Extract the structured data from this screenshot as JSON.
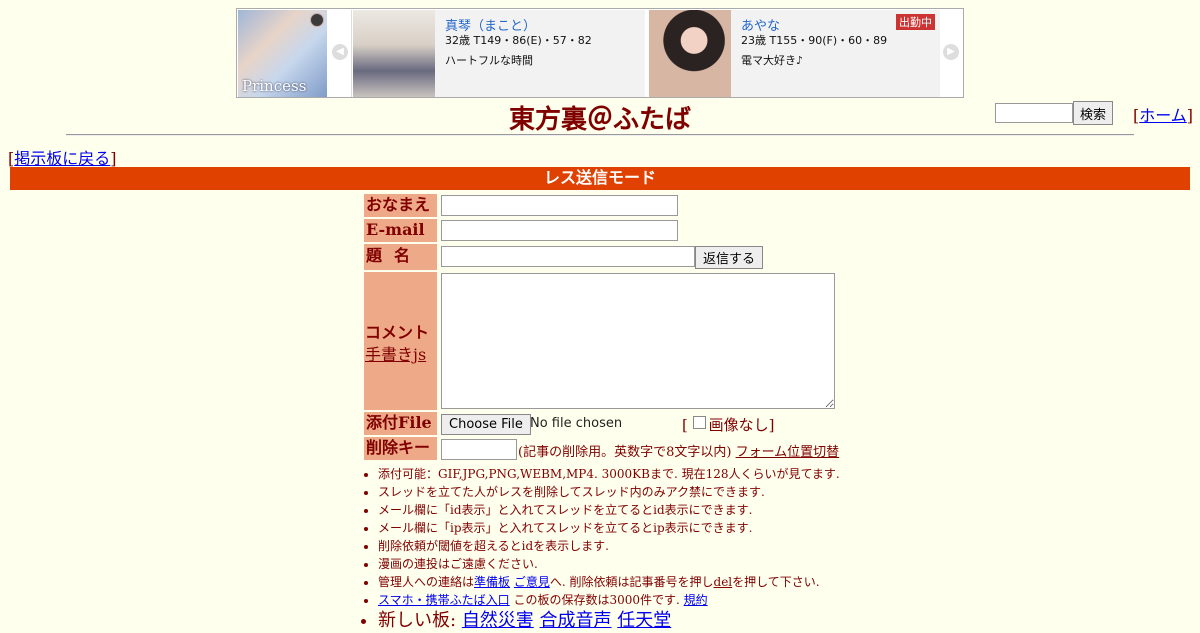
{
  "ad": {
    "logo_text": "Princess",
    "cards": [
      {
        "name": "真琴（まこと）",
        "stats": "32歳 T149・86(E)・57・82",
        "message": "ハートフルな時間",
        "badge": ""
      },
      {
        "name": "あやな",
        "stats": "23歳 T155・90(F)・60・89",
        "message": "電マ大好き♪",
        "badge": "出勤中"
      }
    ]
  },
  "header": {
    "title": "東方裏＠ふたば",
    "search_button": "検索",
    "home_open": "[",
    "home_link": "ホーム",
    "home_close": "]"
  },
  "nav": {
    "back_open": "[",
    "back_link": "掲示板に戻る",
    "back_close": "]"
  },
  "mode_label": "レス送信モード",
  "form": {
    "name_label": "おなまえ",
    "email_label": "E-mail",
    "subject_label": "題名",
    "reply_button": "返信する",
    "comment_label": "コメント",
    "handwrite_link": "手書きjs",
    "file_label": "添付File",
    "file_button": "Choose File",
    "file_status": "No file chosen",
    "no_image_label": "画像なし",
    "no_image_open": "[",
    "no_image_close": "]",
    "delkey_label": "削除キー",
    "delkey_note": "(記事の削除用。英数字で8文字以内)",
    "form_switch_link": "フォーム位置切替"
  },
  "notes": {
    "n1": "添付可能：GIF,JPG,PNG,WEBM,MP4. 3000KBまで. 現在128人くらいが見てます.",
    "n2": "スレッドを立てた人がレスを削除してスレッド内のみアク禁にできます.",
    "n3": "メール欄に「id表示」と入れてスレッドを立てるとid表示にできます.",
    "n4": "メール欄に「ip表示」と入れてスレッドを立てるとip表示にできます.",
    "n5": "削除依頼が閾値を超えるとidを表示します.",
    "n6": "漫画の連投はご遠慮ください.",
    "n7_pre": "管理人への連絡は",
    "n7_link1": "準備板",
    "n7_link2": "ご意見",
    "n7_mid": "へ. 削除依頼は記事番号を押し",
    "n7_del": "del",
    "n7_post": "を押して下さい.",
    "n8_link": "スマホ・携帯ふたば入口",
    "n8_mid": "この板の保存数は3000件です.",
    "n8_rules": "規約",
    "n9_pre": "新しい板:",
    "n9_boards": [
      "自然災害",
      "合成音声",
      "任天堂"
    ]
  }
}
